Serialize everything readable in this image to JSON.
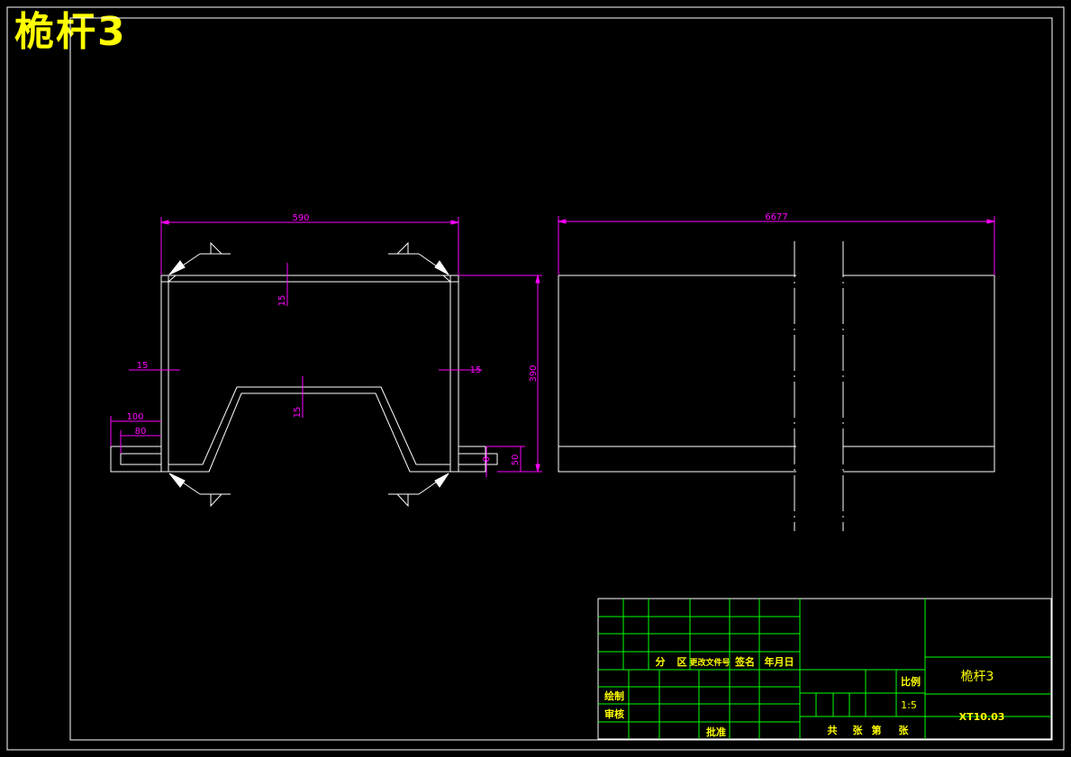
{
  "title": "桅杆3",
  "front_view": {
    "dimensions": {
      "width_top": "590",
      "height_right": "390",
      "top_thickness": "15",
      "left_wall_thickness": "15",
      "right_wall_thickness": "15",
      "inner_plate_thickness": "15",
      "tab_outer_length": "100",
      "tab_inner_length": "80",
      "tab_height_small": "8",
      "tab_height_large": "50"
    }
  },
  "side_view": {
    "dimensions": {
      "length": "6677"
    }
  },
  "title_block": {
    "revision_header": [
      "分",
      "区",
      "更改文件号",
      "签名",
      "年月日"
    ],
    "row_labels": {
      "drafted": "绘制",
      "checked": "审核",
      "approved": "批准"
    },
    "scale_label": "比例",
    "scale_value": "1:5",
    "part_name": "桅杆3",
    "drawing_number": "XT10.03",
    "sheets_text": [
      "共",
      "张",
      "第",
      "张"
    ]
  },
  "colors": {
    "outline": "#ffffff",
    "dimension": "#ff00ff",
    "table": "#00ff00",
    "text": "#ffff00",
    "frame": "#ffffff"
  }
}
